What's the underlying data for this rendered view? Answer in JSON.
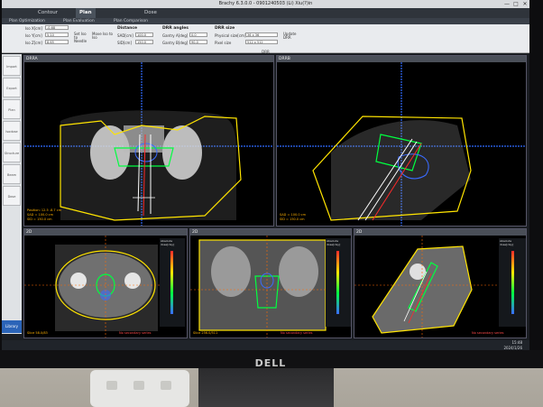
{
  "app": {
    "title": "Brachy 6.3.0.0 - 0901240503 (Li) Xiu(?)in",
    "window_controls": [
      "—",
      "□",
      "✕"
    ]
  },
  "menu": {
    "tabs": [
      {
        "label": "Contour"
      },
      {
        "label": "Plan",
        "active": true
      },
      {
        "label": "Dose"
      }
    ]
  },
  "subtabs": [
    "Plan Optimization",
    "Plan Evaluation",
    "Plan Comparison"
  ],
  "toolbar": {
    "left_fields": [
      {
        "label": "Iso X[cm]",
        "value": "-0.68"
      },
      {
        "label": "Iso Y[cm]",
        "value": "5.10"
      },
      {
        "label": "Iso Z[cm]",
        "value": "8.65"
      }
    ],
    "small_buttons": [
      "Set Iso to Needle",
      "Move Iso to Iso"
    ],
    "distance": {
      "title": "Distance",
      "fields": [
        {
          "label": "SAD[cm]",
          "value": "100.0"
        },
        {
          "label": "SID[cm]",
          "value": "150.0"
        }
      ]
    },
    "drr_angles": {
      "title": "DRR angles",
      "fields": [
        {
          "label": "Gantry A[deg]",
          "value": "0.0"
        },
        {
          "label": "Gantry B[deg]",
          "value": "90.0"
        }
      ]
    },
    "drr_size": {
      "title": "DRR size",
      "fields": [
        {
          "label": "Physical size[cm]",
          "value": "36 x 36"
        },
        {
          "label": "Pixel size",
          "value": "512 x 512"
        }
      ]
    },
    "update_button": "Update DRR",
    "section_label": "DRR"
  },
  "left_panel": {
    "buttons": [
      "Import Plan",
      "Export",
      "Plan Report",
      "Isodose",
      "Structure",
      "Beam",
      "Dose"
    ],
    "footer": "Library"
  },
  "viewports": {
    "drr_a": {
      "header": "DRRA",
      "info_lines": [
        "Position: 12.5 -8.7 cm",
        "SAD = 100.0 cm",
        "SID = 150.0 cm"
      ]
    },
    "drr_b": {
      "header": "DRRB",
      "info_lines": [
        "SAD = 100.0 cm",
        "SID = 150.0 cm"
      ]
    },
    "axial": {
      "header": "2D",
      "footer_left": "Slice 58.0/83",
      "footer_right": "No secondary series",
      "panel_title": "Absolute dose[cGy]"
    },
    "coronal": {
      "header": "2D",
      "footer_left": "Slice 256.0/511",
      "footer_right": "No secondary series",
      "panel_title": "Absolute dose[cGy]"
    },
    "sagittal": {
      "header": "2D",
      "footer_left": "",
      "footer_right": "No secondary series",
      "panel_title": "Absolute dose[cGy]"
    }
  },
  "status": {
    "time": "15:48",
    "date": "2024/1/26"
  },
  "monitor": {
    "brand": "DELL"
  },
  "colors": {
    "body_contour": "#ffe400",
    "ptv": "#00ff40",
    "oar_blue": "#3a6bff",
    "oar_red": "#ff2a2a",
    "crosshair": "#2f6bff",
    "needle": "#ffffff"
  }
}
